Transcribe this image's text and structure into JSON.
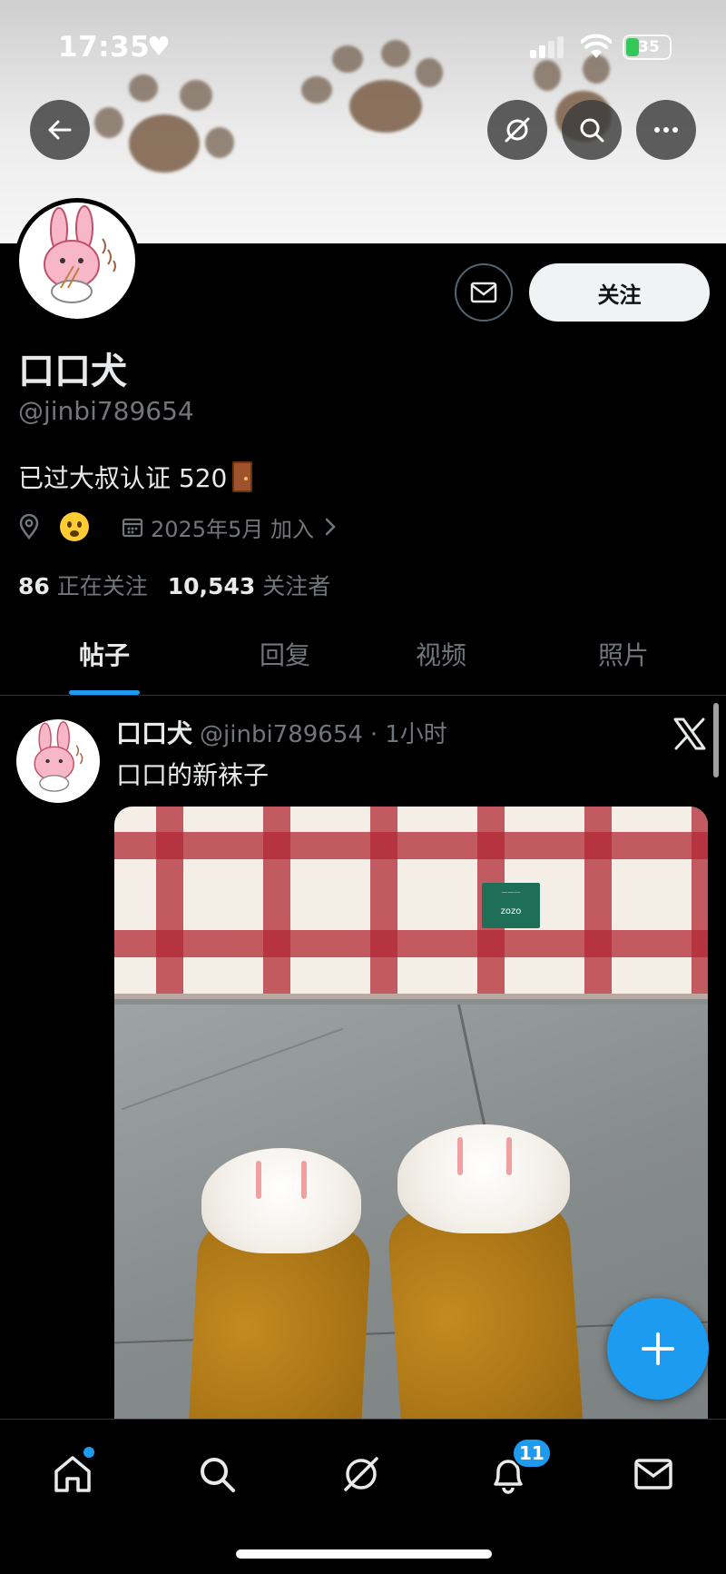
{
  "status_bar": {
    "time": "17:35",
    "battery": "35"
  },
  "profile": {
    "follow_label": "关注",
    "name": "口口犬",
    "handle": "@jinbi789654",
    "bio": "已过大叔认证 520",
    "joined": "2025年5月 加入",
    "following_count": "86",
    "following_label": "正在关注",
    "followers_count": "10,543",
    "followers_label": "关注者"
  },
  "tabs": [
    {
      "label": "帖子",
      "active": true
    },
    {
      "label": "回复",
      "active": false
    },
    {
      "label": "视频",
      "active": false
    },
    {
      "label": "照片",
      "active": false
    }
  ],
  "post": {
    "author": "口口犬",
    "handle": "@jinbi789654",
    "separator": "·",
    "time": "1小时",
    "text": "口口的新袜子",
    "photo_tag": "zozo"
  },
  "bottom_nav": {
    "notification_count": "11"
  },
  "colors": {
    "accent": "#1d9bf0",
    "background": "#000000",
    "secondary_text": "#71767b"
  },
  "icons": [
    "back-arrow-icon",
    "grok-icon",
    "search-icon",
    "more-icon",
    "mail-icon",
    "location-icon",
    "calendar-icon",
    "chevron-right-icon",
    "x-logo-icon",
    "plus-icon",
    "home-icon",
    "bell-icon"
  ]
}
